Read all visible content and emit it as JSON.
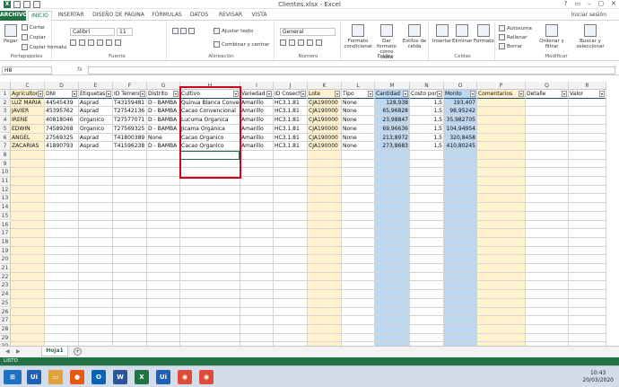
{
  "window": {
    "title": "Clientes.xlsx - Excel",
    "controls": [
      "?",
      "▭",
      "–",
      "▢",
      "✕"
    ],
    "signin": "Iniciar sesión"
  },
  "tabs": [
    "ARCHIVO",
    "INICIO",
    "INSERTAR",
    "DISEÑO DE PÁGINA",
    "FÓRMULAS",
    "DATOS",
    "REVISAR",
    "VISTA"
  ],
  "ribbon": {
    "paste": "Pegar",
    "cut": "Cortar",
    "copy": "Copiar",
    "format_painter": "Copiar formato",
    "clipboard_group": "Portapapeles",
    "font_name": "Calibri",
    "font_size": "11",
    "font_group": "Fuente",
    "wrap_text": "Ajustar texto",
    "merge_center": "Combinar y centrar",
    "alignment_group": "Alineación",
    "number_format": "General",
    "number_group": "Número",
    "cond_format": "Formato condicional",
    "format_table": "Dar formato como tabla",
    "cell_styles": "Estilos de celda",
    "styles_group": "Estilos",
    "insert": "Insertar",
    "delete": "Eliminar",
    "format": "Formato",
    "cells_group": "Celdas",
    "autosum": "Autosuma",
    "fill": "Rellenar",
    "clear": "Borrar",
    "sort_filter": "Ordenar y filtrar",
    "find_select": "Buscar y seleccionar",
    "modify_group": "Modificar"
  },
  "formula_bar": {
    "name_box": "H8",
    "fx": "fx",
    "value": ""
  },
  "columns": [
    "C",
    "D",
    "E",
    "F",
    "G",
    "H",
    "I",
    "J",
    "K",
    "L",
    "M",
    "N",
    "O",
    "P",
    "Q",
    "R"
  ],
  "row_numbers": [
    "1",
    "2",
    "3",
    "4",
    "5",
    "6",
    "7",
    "8",
    "9",
    "10",
    "11",
    "12",
    "13",
    "14",
    "15",
    "16",
    "17",
    "18",
    "19",
    "20",
    "21",
    "22",
    "23",
    "24",
    "25",
    "26",
    "27",
    "28",
    "29",
    "30"
  ],
  "table": {
    "headers": [
      "Agricultor",
      "DNI",
      "Etiquetas",
      "ID Terreno",
      "Distrito",
      "Cultivo",
      "Variedad",
      "ID Cosecha",
      "Lote",
      "Tipo",
      "Cantidad",
      "Costo por",
      "Monto",
      "Comentarios",
      "Detalle",
      "Valor"
    ],
    "rows": [
      [
        "LUZ MARIA",
        "44545439",
        "Asprad",
        "T43159481",
        "D - BAMBA",
        "Quinua Blanca Convencional",
        "Amarillo",
        "HC3.1.81",
        "CJA190000",
        "None",
        "128,938",
        "1,5",
        "193,407",
        "",
        "",
        ""
      ],
      [
        "JAVIER",
        "45395762",
        "Asprad",
        "T27542136",
        "D - BAMBA",
        "Cacao Convencional",
        "Amarillo",
        "HC3.1.81",
        "CJA190000",
        "None",
        "65,96828",
        "1,5",
        "98,95242",
        "",
        "",
        ""
      ],
      [
        "IRENE",
        "40818046",
        "Organico",
        "T27577071",
        "D - BAMBA",
        "Lucuma Organica",
        "Amarillo",
        "HC3.1.81",
        "CJA190000",
        "None",
        "23,98847",
        "1,5",
        "35,982705",
        "",
        "",
        ""
      ],
      [
        "EDWIN",
        "74589268",
        "Organico",
        "T27569325",
        "D - BAMBA",
        "Jicama Orgánica",
        "Amarillo",
        "HC3.1.81",
        "CJA190000",
        "None",
        "69,96636",
        "1,5",
        "104,94954",
        "",
        "",
        ""
      ],
      [
        "ANGEL",
        "27569325",
        "Asprad",
        "T41800389",
        "None",
        "Cacao Organico",
        "Amarillo",
        "HC3.1.81",
        "CJA190000",
        "None",
        "213,8972",
        "1,5",
        "320,8458",
        "",
        "",
        ""
      ],
      [
        "ZACARIAS",
        "41890793",
        "Asprad",
        "T41596238",
        "D - BAMBA",
        "Cacao Organico",
        "Amarillo",
        "HC3.1.81",
        "CJA190000",
        "None",
        "273,8683",
        "1,5",
        "410,80245",
        "",
        "",
        ""
      ]
    ]
  },
  "sheet": {
    "tab": "Hoja1",
    "add": "+"
  },
  "status": {
    "ready": "LISTO"
  },
  "taskbar": {
    "apps": [
      "Ui",
      "Explorer",
      "Firefox",
      "Outlook",
      "Word",
      "Excel",
      "Ui",
      "Chrome",
      "Chrome"
    ],
    "time": "10:43",
    "date": "20/03/2020"
  },
  "colors": {
    "excel_green": "#217346",
    "highlight_yellow": "#fff2cc",
    "highlight_blue": "#bdd7ee",
    "annotation_red": "#d0021b"
  }
}
